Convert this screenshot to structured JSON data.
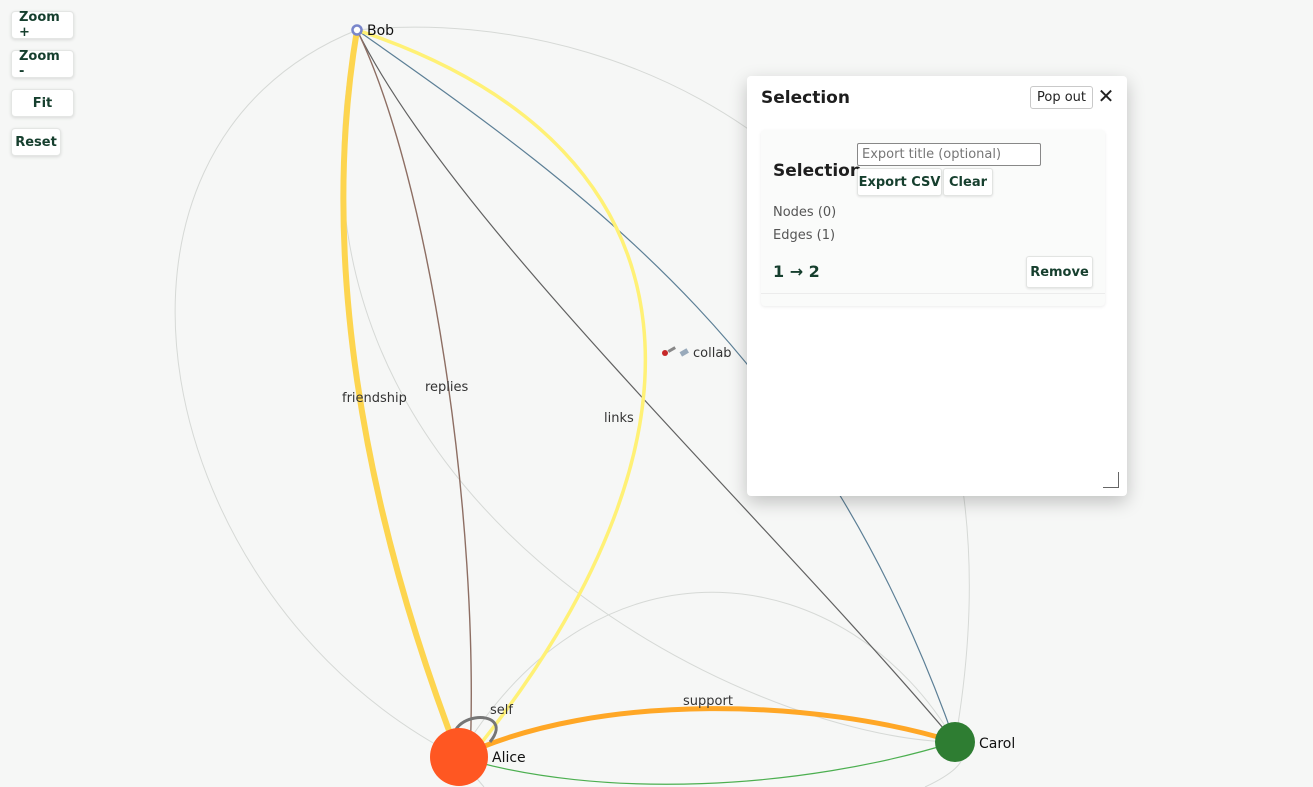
{
  "zoom_controls": {
    "zoom_in": "Zoom +",
    "zoom_out": "Zoom -",
    "fit": "Fit",
    "reset": "Reset"
  },
  "graph": {
    "nodes": [
      {
        "id": "bob",
        "label": "Bob",
        "color": "#7986cb"
      },
      {
        "id": "alice",
        "label": "Alice",
        "color": "#ff5722"
      },
      {
        "id": "carol",
        "label": "Carol",
        "color": "#2e7d32"
      }
    ],
    "edges": [
      {
        "label": "friendship",
        "color": "#fdd54f"
      },
      {
        "label": "replies",
        "color": "#8d6e63"
      },
      {
        "label": "links",
        "color": "#616161"
      },
      {
        "label": "collab",
        "color": "#fff176",
        "icon": "rocket-icon"
      },
      {
        "label": "support",
        "color": "#ffa726"
      },
      {
        "label": "self",
        "color": "#757575"
      }
    ]
  },
  "selection_panel": {
    "title": "Selection",
    "popout_label": "Pop out",
    "close_symbol": "✕",
    "card": {
      "title": "Selection",
      "export_placeholder": "Export title (optional)",
      "export_value": "",
      "export_csv_label": "Export CSV",
      "clear_label": "Clear",
      "nodes_count": "Nodes (0)",
      "edges_count": "Edges (1)",
      "selected_edge": "1 → 2",
      "remove_label": "Remove"
    }
  }
}
